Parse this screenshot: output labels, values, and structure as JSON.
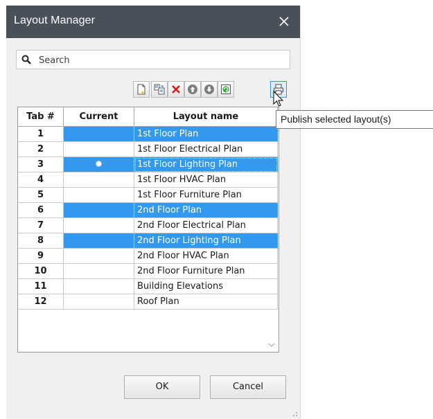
{
  "window": {
    "title": "Layout Manager"
  },
  "search": {
    "placeholder": "Search"
  },
  "toolbar": {
    "buttons": [
      {
        "icon": "new-layout-icon"
      },
      {
        "icon": "copy-layout-icon"
      },
      {
        "icon": "delete-icon"
      },
      {
        "icon": "move-up-icon"
      },
      {
        "icon": "move-down-icon"
      },
      {
        "icon": "refresh-icon"
      },
      {
        "icon": "print-icon"
      }
    ]
  },
  "table": {
    "headers": {
      "tab": "Tab #",
      "current": "Current",
      "name": "Layout name"
    },
    "rows": [
      {
        "tab": "1",
        "name": "1st Floor Plan",
        "selected": true,
        "current": false
      },
      {
        "tab": "2",
        "name": "1st Floor Electrical Plan",
        "selected": false,
        "current": false
      },
      {
        "tab": "3",
        "name": "1st Floor Lighting Plan",
        "selected": true,
        "current": true
      },
      {
        "tab": "4",
        "name": "1st Floor HVAC Plan",
        "selected": false,
        "current": false
      },
      {
        "tab": "5",
        "name": "1st Floor Furniture Plan",
        "selected": false,
        "current": false
      },
      {
        "tab": "6",
        "name": "2nd Floor Plan",
        "selected": true,
        "current": false
      },
      {
        "tab": "7",
        "name": "2nd Floor Electrical Plan",
        "selected": false,
        "current": false
      },
      {
        "tab": "8",
        "name": "2nd Floor Lighting Plan",
        "selected": true,
        "current": false
      },
      {
        "tab": "9",
        "name": "2nd Floor HVAC Plan",
        "selected": false,
        "current": false
      },
      {
        "tab": "10",
        "name": "2nd Floor Furniture Plan",
        "selected": false,
        "current": false
      },
      {
        "tab": "11",
        "name": "Building Elevations",
        "selected": false,
        "current": false
      },
      {
        "tab": "12",
        "name": "Roof Plan",
        "selected": false,
        "current": false
      }
    ]
  },
  "buttons": {
    "ok": "OK",
    "cancel": "Cancel"
  },
  "tooltip": {
    "text": "Publish selected layout(s)"
  },
  "colors": {
    "titlebar": "#49505a",
    "selection": "#3399ee",
    "dialog_bg": "#f0f0f0"
  }
}
